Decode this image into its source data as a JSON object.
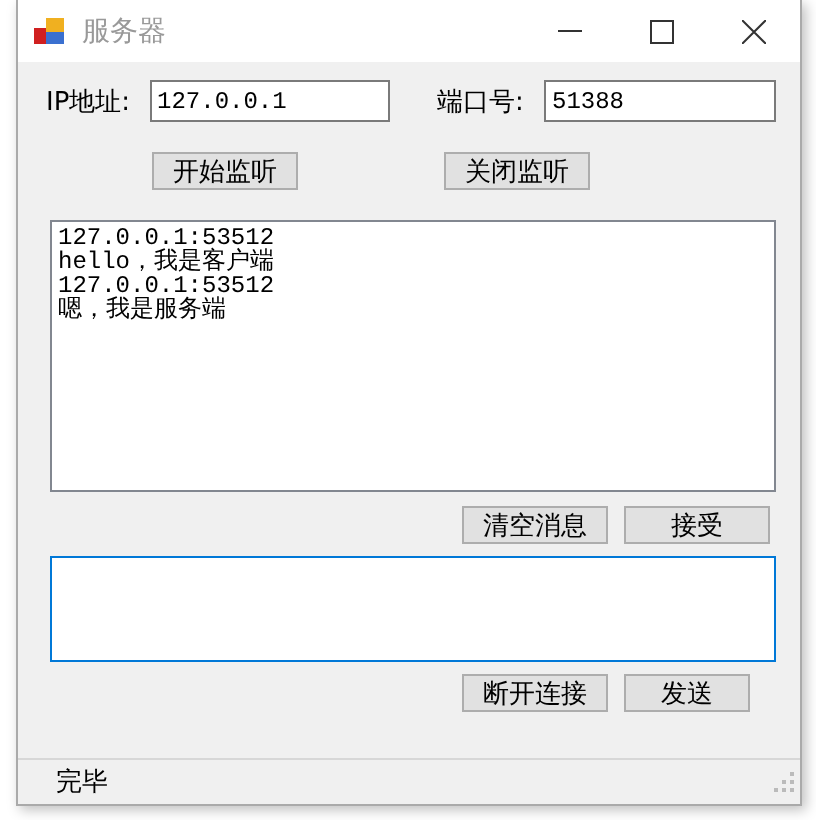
{
  "window": {
    "title": "服务器"
  },
  "ip_field": {
    "label": "IP地址:",
    "value": "127.0.0.1"
  },
  "port_field": {
    "label": "端口号:",
    "value": "51388"
  },
  "listen_buttons": [
    "开始监听",
    "关闭监听"
  ],
  "message_log": [
    "127.0.0.1:53512",
    "hello，我是客户端",
    "127.0.0.1:53512",
    "嗯，我是服务端"
  ],
  "log_buttons": [
    "清空消息",
    "接受"
  ],
  "compose": {
    "focused": true
  },
  "send_buttons": [
    "断开连接",
    "发送"
  ],
  "status_bar": {
    "text": "完毕"
  }
}
